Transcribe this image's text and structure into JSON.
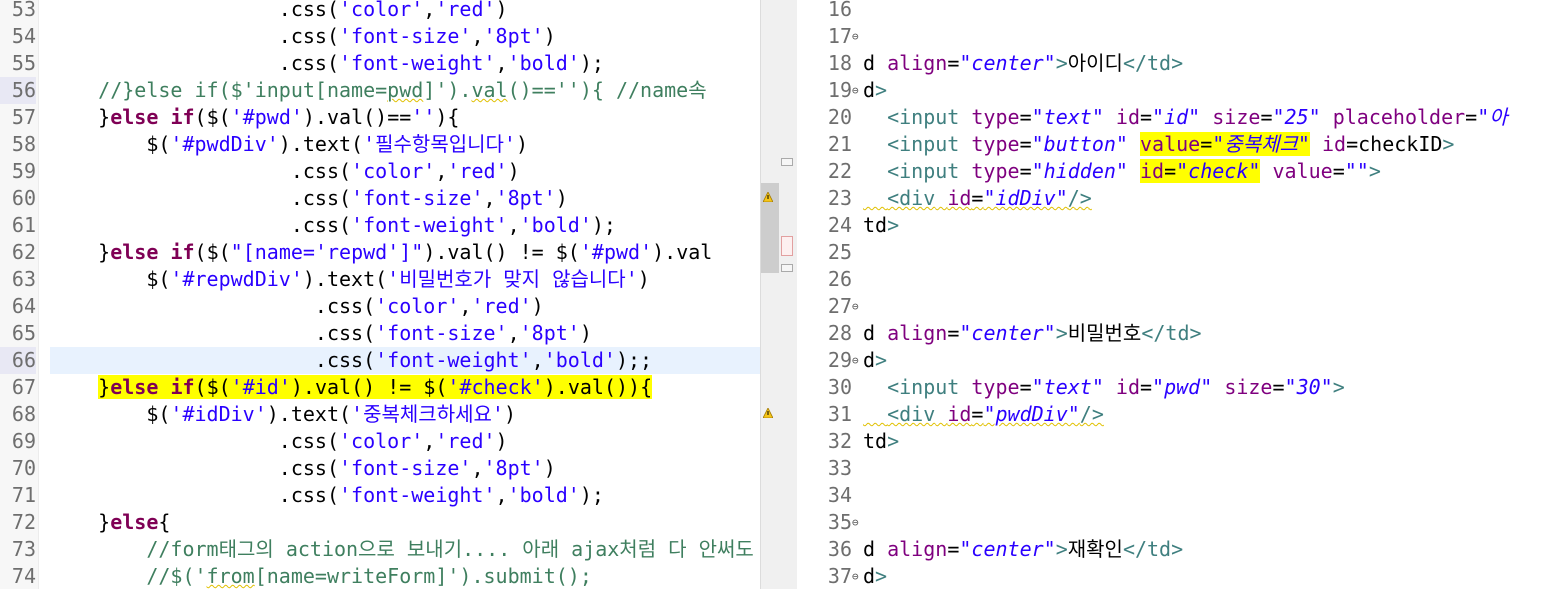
{
  "left_editor": {
    "lines": [
      {
        "n": "53",
        "code": "                   .css('color','red')"
      },
      {
        "n": "54",
        "code": "                   .css('font-size','8pt')"
      },
      {
        "n": "55",
        "code": "                   .css('font-weight','bold');"
      },
      {
        "n": "56",
        "code": "    //}else if($'input[name=pwd]').val()==''){ //name속"
      },
      {
        "n": "57",
        "code": "    }else if($('#pwd').val()==''){"
      },
      {
        "n": "58",
        "code": "        $('#pwdDiv').text('필수항목입니다')"
      },
      {
        "n": "59",
        "code": "                    .css('color','red')"
      },
      {
        "n": "60",
        "code": "                    .css('font-size','8pt')"
      },
      {
        "n": "61",
        "code": "                    .css('font-weight','bold');"
      },
      {
        "n": "62",
        "code": "    }else if($(\"[name='repwd']\").val() != $('#pwd').val"
      },
      {
        "n": "63",
        "code": "        $('#repwdDiv').text('비밀번호가 맞지 않습니다')"
      },
      {
        "n": "64",
        "code": "                      .css('color','red')"
      },
      {
        "n": "65",
        "code": "                      .css('font-size','8pt')"
      },
      {
        "n": "66",
        "code": "                      .css('font-weight','bold');;"
      },
      {
        "n": "67",
        "code": "    }else if($('#id').val() != $('#check').val()){"
      },
      {
        "n": "68",
        "code": "        $('#idDiv').text('중복체크하세요')"
      },
      {
        "n": "69",
        "code": "                   .css('color','red')"
      },
      {
        "n": "70",
        "code": "                   .css('font-size','8pt')"
      },
      {
        "n": "71",
        "code": "                   .css('font-weight','bold');"
      },
      {
        "n": "72",
        "code": "    }else{"
      },
      {
        "n": "73",
        "code": "        //form태그의 action으로 보내기.... 아래 ajax처럼 다 안써도"
      },
      {
        "n": "74",
        "code": "        //$('from[name=writeForm]').submit();"
      }
    ]
  },
  "right_editor": {
    "lines": [
      {
        "n": "16",
        "code": ""
      },
      {
        "n": "17",
        "code": ""
      },
      {
        "n": "18",
        "code": "d align=\"center\">아이디</td>"
      },
      {
        "n": "19",
        "code": "d>"
      },
      {
        "n": "20",
        "code": "  <input type=\"text\" id=\"id\" size=\"25\" placeholder=\"아"
      },
      {
        "n": "21",
        "code": "  <input type=\"button\" value=\"중복체크\" id=checkID>"
      },
      {
        "n": "22",
        "code": "  <input type=\"hidden\" id=\"check\" value=\"\">"
      },
      {
        "n": "23",
        "code": "  <div id=\"idDiv\"/>"
      },
      {
        "n": "24",
        "code": "td>"
      },
      {
        "n": "25",
        "code": ""
      },
      {
        "n": "26",
        "code": ""
      },
      {
        "n": "27",
        "code": ""
      },
      {
        "n": "28",
        "code": "d align=\"center\">비밀번호</td>"
      },
      {
        "n": "29",
        "code": "d>"
      },
      {
        "n": "30",
        "code": "  <input type=\"text\" id=\"pwd\" size=\"30\">"
      },
      {
        "n": "31",
        "code": "  <div id=\"pwdDiv\"/>"
      },
      {
        "n": "32",
        "code": "td>"
      },
      {
        "n": "33",
        "code": ""
      },
      {
        "n": "34",
        "code": ""
      },
      {
        "n": "35",
        "code": ""
      },
      {
        "n": "36",
        "code": "d align=\"center\">재확인</td>"
      },
      {
        "n": "37",
        "code": "d>"
      }
    ]
  },
  "colors": {
    "keyword": "#7f0055",
    "string": "#2a00ff",
    "comment": "#3f7f5f",
    "tag": "#3f7f7f",
    "attribute": "#7f007f",
    "highlight": "#ffff00",
    "current_line": "#e8f2fe"
  },
  "icons": [
    "warning-icon",
    "fold-icon"
  ]
}
